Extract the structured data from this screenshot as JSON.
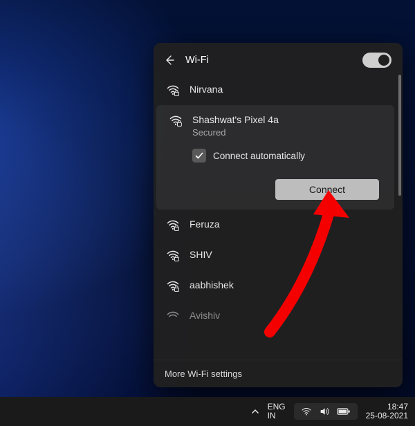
{
  "panel": {
    "title": "Wi-Fi",
    "toggle_on": true,
    "more_settings": "More Wi-Fi settings"
  },
  "networks": [
    {
      "name": "Nirvana",
      "secured": true
    },
    {
      "name": "Shashwat's Pixel 4a",
      "secured": true,
      "secured_label": "Secured",
      "selected": true
    },
    {
      "name": "Feruza",
      "secured": true
    },
    {
      "name": "SHIV",
      "secured": true
    },
    {
      "name": "aabhishek",
      "secured": true
    },
    {
      "name": "Avishiv",
      "secured": true
    }
  ],
  "selected": {
    "auto_connect_label": "Connect automatically",
    "auto_connect_checked": true,
    "connect_label": "Connect"
  },
  "taskbar": {
    "lang1": "ENG",
    "lang2": "IN",
    "time": "18:47",
    "date": "25-08-2021"
  },
  "colors": {
    "panel_bg": "#202020",
    "accent_arrow": "#f40000"
  }
}
